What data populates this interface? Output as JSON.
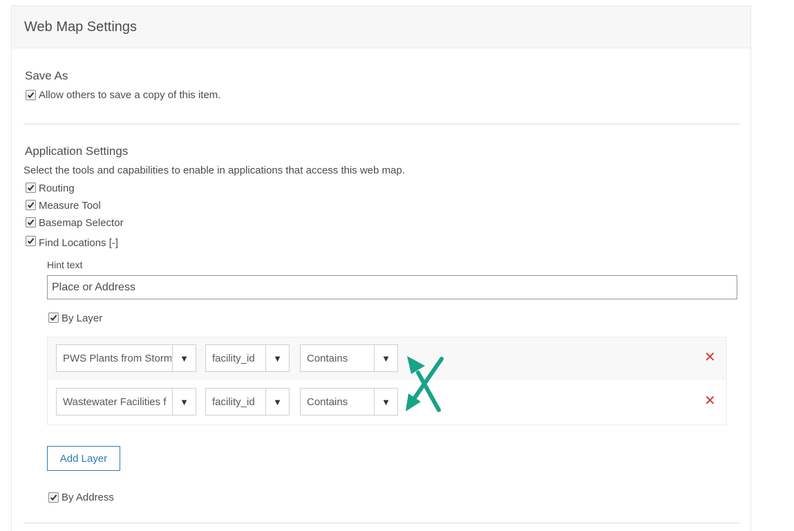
{
  "panel": {
    "title": "Web Map Settings"
  },
  "save_as": {
    "title": "Save As",
    "allow_copy": {
      "label": "Allow others to save a copy of this item.",
      "checked": true
    }
  },
  "app_settings": {
    "title": "Application Settings",
    "description": "Select the tools and capabilities to enable in applications that access this web map.",
    "routing": {
      "label": "Routing",
      "checked": true
    },
    "measure": {
      "label": "Measure Tool",
      "checked": true
    },
    "basemap": {
      "label": "Basemap Selector",
      "checked": true
    },
    "find_locations": {
      "label": "Find Locations",
      "toggle": "[-]",
      "checked": true
    }
  },
  "find_locations": {
    "hint_label": "Hint text",
    "hint_value": "Place or Address",
    "by_layer": {
      "label": "By Layer",
      "checked": true
    },
    "layers": [
      {
        "layer": "PWS Plants from Storm",
        "field": "facility_id",
        "operator": "Contains"
      },
      {
        "layer": "Wastewater Facilities f",
        "field": "facility_id",
        "operator": "Contains"
      }
    ],
    "add_layer_label": "Add Layer",
    "by_address": {
      "label": "By Address",
      "checked": true
    }
  },
  "icons": {
    "dropdown": "▼",
    "remove": "✕"
  },
  "colors": {
    "accent": "#2b7bb5",
    "remove": "#d43a2f",
    "annotation_arrow": "#1aa289"
  }
}
